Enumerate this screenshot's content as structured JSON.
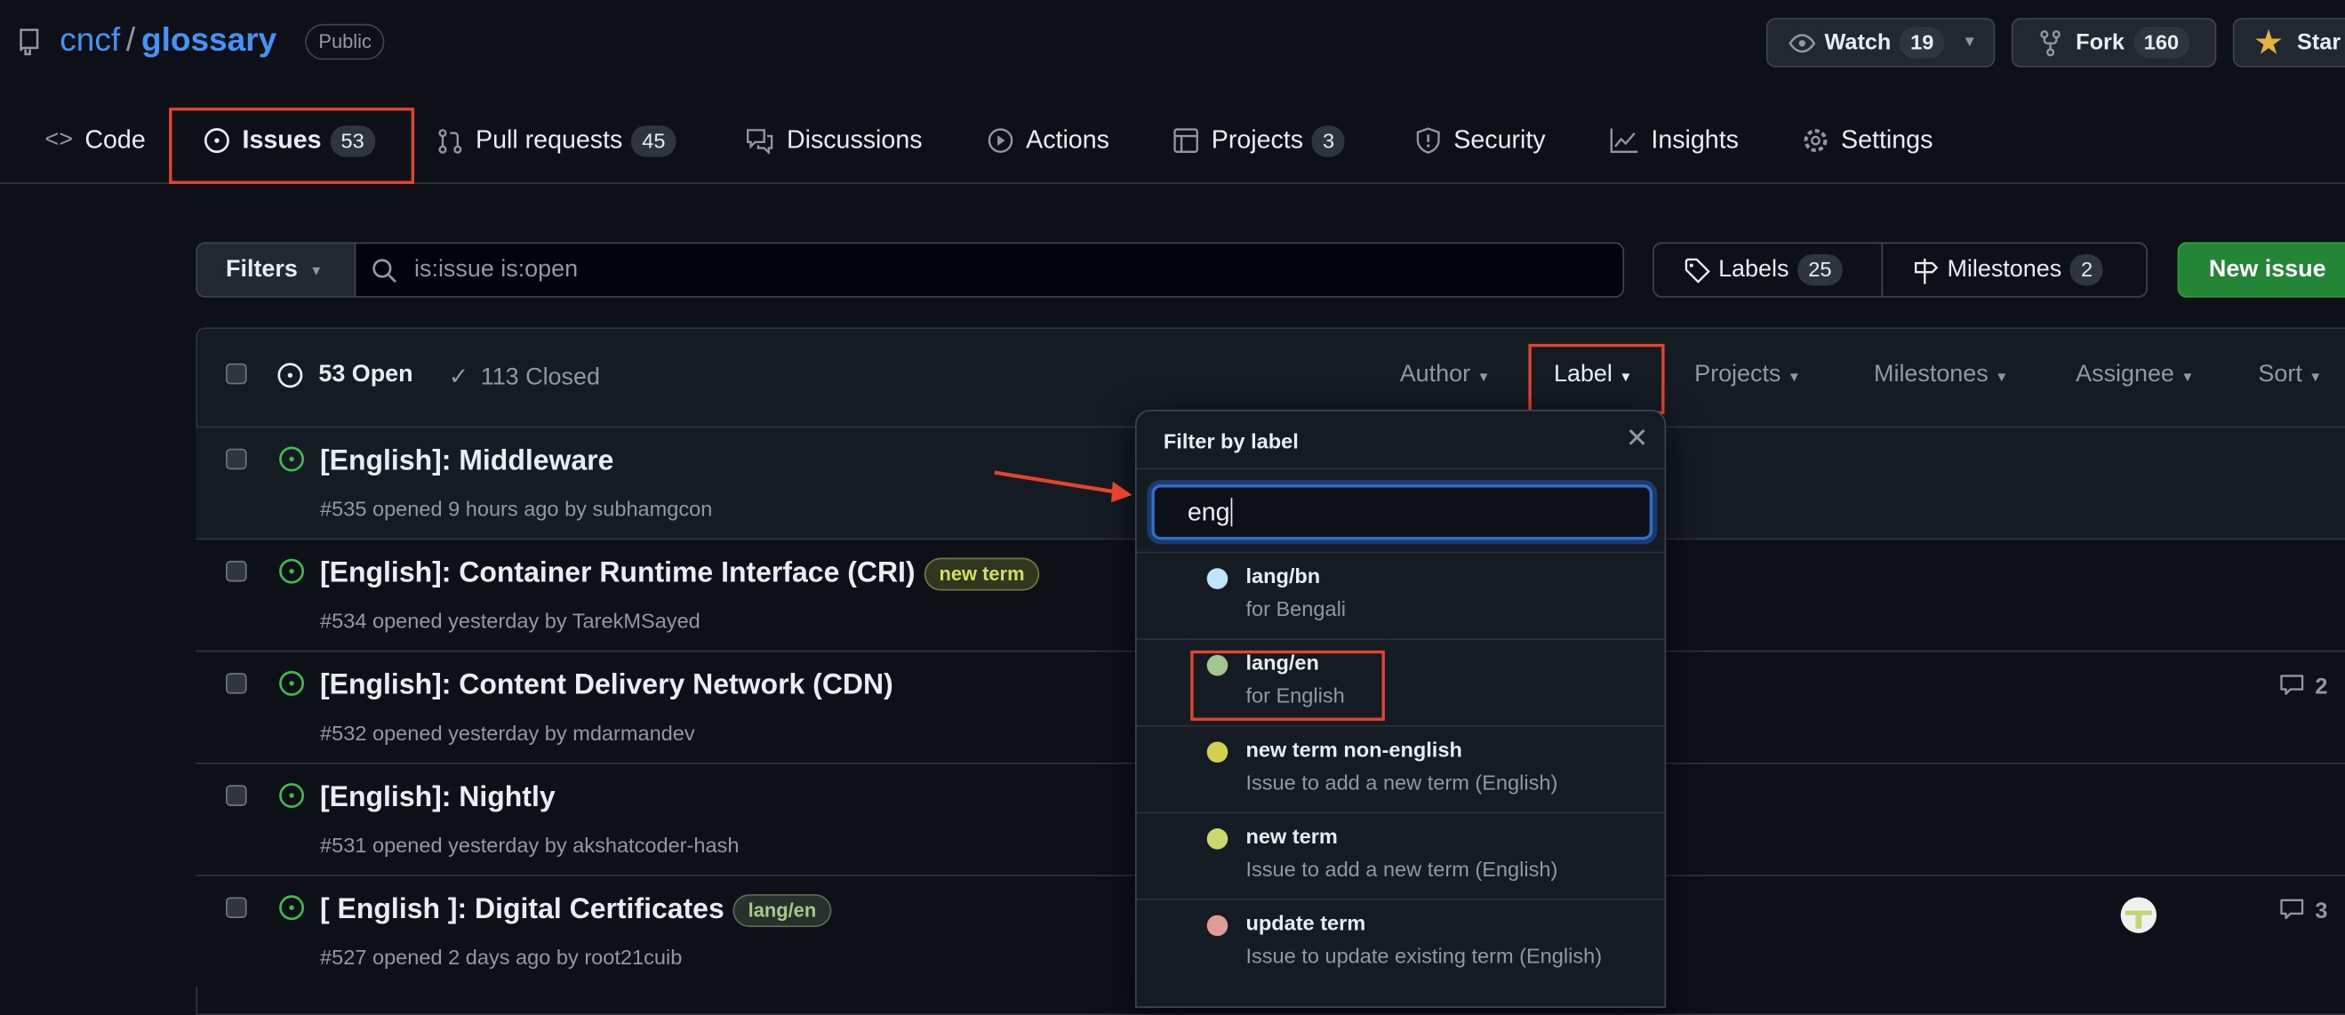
{
  "repo": {
    "owner": "cncf",
    "separator": "/",
    "name": "glossary",
    "visibility": "Public"
  },
  "actions": {
    "watch": {
      "label": "Watch",
      "count": "19"
    },
    "fork": {
      "label": "Fork",
      "count": "160"
    },
    "star": {
      "label": "Star"
    }
  },
  "tabs": [
    {
      "label": "Code"
    },
    {
      "label": "Issues",
      "count": "53"
    },
    {
      "label": "Pull requests",
      "count": "45"
    },
    {
      "label": "Discussions"
    },
    {
      "label": "Actions"
    },
    {
      "label": "Projects",
      "count": "3"
    },
    {
      "label": "Security"
    },
    {
      "label": "Insights"
    },
    {
      "label": "Settings"
    }
  ],
  "filterbar": {
    "filters_label": "Filters",
    "search_value": "is:issue is:open",
    "labels_label": "Labels",
    "labels_count": "25",
    "milestones_label": "Milestones",
    "milestones_count": "2",
    "new_issue_label": "New issue"
  },
  "list_header": {
    "open": "53 Open",
    "closed": "113 Closed",
    "filters": [
      "Author",
      "Label",
      "Projects",
      "Milestones",
      "Assignee",
      "Sort"
    ]
  },
  "issues": [
    {
      "title": "[English]: Middleware",
      "meta": "#535 opened 9 hours ago by subhamgcon"
    },
    {
      "title": "[English]: Container Runtime Interface (CRI)",
      "label": "new term",
      "label_color": "#d4e157",
      "meta": "#534 opened yesterday by TarekMSayed"
    },
    {
      "title": "[English]: Content Delivery Network (CDN)",
      "meta": "#532 opened yesterday by mdarmandev",
      "comments": "2"
    },
    {
      "title": "[English]: Nightly",
      "meta": "#531 opened yesterday by akshatcoder-hash"
    },
    {
      "title": "[ English ]: Digital Certificates",
      "label": "lang/en",
      "label_color": "#a6c98f",
      "meta": "#527 opened 2 days ago by root21cuib",
      "comments": "3"
    }
  ],
  "label_dropdown": {
    "title": "Filter by label",
    "search_value": "eng",
    "items": [
      {
        "name": "lang/bn",
        "description": "for Bengali",
        "color": "#bfe5fb"
      },
      {
        "name": "lang/en",
        "description": "for English",
        "color": "#a3c590"
      },
      {
        "name": "new term non-english",
        "description": "Issue to add a new term (English)",
        "color": "#cfd14f"
      },
      {
        "name": "new term",
        "description": "Issue to add a new term (English)",
        "color": "#ccd86a"
      },
      {
        "name": "update term",
        "description": "Issue to update existing term (English)",
        "color": "#e09a98"
      }
    ]
  },
  "colors": {
    "accent": "#4493f8",
    "open": "#3fb950",
    "primary_button": "#238636",
    "annotation": "#e5432b"
  }
}
